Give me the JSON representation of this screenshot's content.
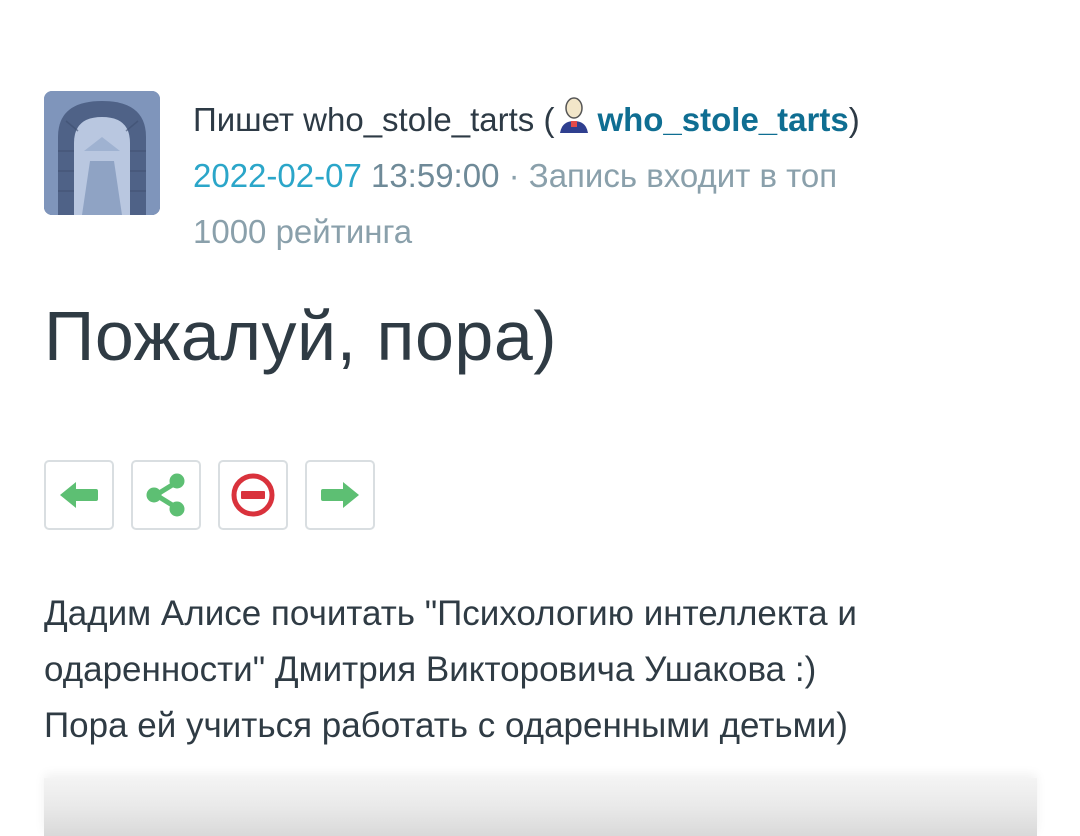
{
  "author": {
    "prefix": "Пишет who_stole_tarts (",
    "username": "who_stole_tarts",
    "suffix": ")",
    "user_icon": "user-icon"
  },
  "entry_meta": {
    "date": "2022-02-07",
    "time": " 13:59:00",
    "separator": " · ",
    "rating_line1": "Запись входит в топ",
    "rating_line2": "1000 рейтинга"
  },
  "post": {
    "title": "Пожалуй, пора)",
    "body_line1": "Дадим Алисе почитать \"Психологию интеллекта и",
    "body_line2": "одаренности\" Дмитрия Викторовича Ушакова :)",
    "body_line3": "Пора ей учиться работать с одаренными детьми)"
  },
  "toolbar": {
    "buttons": [
      {
        "icon": "arrow-left-icon",
        "color": "#5dbf73"
      },
      {
        "icon": "share-icon",
        "color": "#5dbf73"
      },
      {
        "icon": "block-icon",
        "color": "#d9323c"
      },
      {
        "icon": "arrow-right-icon",
        "color": "#5dbf73"
      }
    ]
  },
  "colors": {
    "link": "#0f6e92",
    "date": "#2ba6c9",
    "muted": "#8aa0ab",
    "text": "#2f3b44"
  }
}
